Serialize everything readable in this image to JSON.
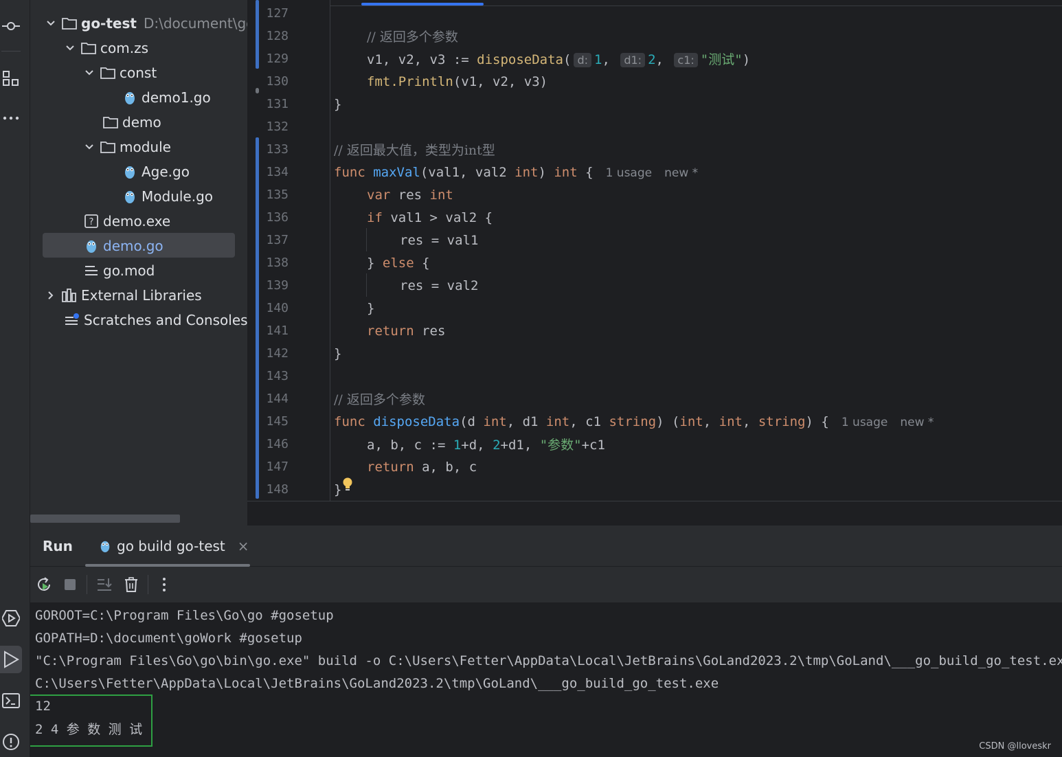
{
  "project": {
    "root_name": "go-test",
    "root_path": "D:\\document\\go\\",
    "items": [
      {
        "label": "com.zs",
        "type": "folder"
      },
      {
        "label": "const",
        "type": "folder"
      },
      {
        "label": "demo1.go",
        "type": "go-file"
      },
      {
        "label": "demo",
        "type": "folder"
      },
      {
        "label": "module",
        "type": "folder"
      },
      {
        "label": "Age.go",
        "type": "go-file"
      },
      {
        "label": "Module.go",
        "type": "go-file"
      },
      {
        "label": "demo.exe",
        "type": "unknown-file"
      },
      {
        "label": "demo.go",
        "type": "go-file",
        "selected": true
      },
      {
        "label": "go.mod",
        "type": "mod-file"
      },
      {
        "label": "External Libraries",
        "type": "library"
      },
      {
        "label": "Scratches and Consoles",
        "type": "scratches"
      }
    ]
  },
  "editor": {
    "line_numbers": [
      "127",
      "128",
      "129",
      "130",
      "131",
      "132",
      "133",
      "134",
      "135",
      "136",
      "137",
      "138",
      "139",
      "140",
      "141",
      "142",
      "143",
      "144",
      "145",
      "146",
      "147",
      "148"
    ],
    "inlay_hints": [
      "d:",
      "d1:",
      "c1:"
    ],
    "usage_hint": "1 usage",
    "new_hint": "new *",
    "code": {
      "l128_comment": "// 返回多个参数",
      "l129_lhs": "v1, v2, v3 := ",
      "l129_fn": "disposeData",
      "l129_a1": "1",
      "l129_a2": "2",
      "l129_a3": "\"测试\"",
      "l130_pkg": "fmt.",
      "l130_fn": "Println",
      "l130_args": "(v1, v2, v3)",
      "brace_close": "}",
      "l133_comment": "// 返回最大值，类型为int型",
      "kw_func": "func",
      "l134_fn": "maxVal",
      "l134_params": "(val1, val2 ",
      "type_int": "int",
      "type_string": "string",
      "l134_rest": ") ",
      "brace_open": " {",
      "kw_var": "var",
      "l135_name": " res ",
      "kw_if": "if",
      "l136_cond": " val1 > val2 {",
      "l137_stmt": "res = val1",
      "l138_close": "} ",
      "kw_else": "else",
      "l138_open": " {",
      "l139_stmt": "res = val2",
      "kw_return": "return",
      "l141_val": " res",
      "l144_comment": "// 返回多个参数",
      "l145_fn": "disposeData",
      "l145_p1": "(d ",
      "l145_p2": ", d1 ",
      "l145_p3": ", c1 ",
      "l145_p4": ") (",
      "comma": ", ",
      "l145_p5": ") {",
      "l146_a": "a, b, c := ",
      "l146_n1": "1",
      "l146_p": "+d, ",
      "l146_n2": "2",
      "l146_q": "+d1, ",
      "l146_s": "\"参数\"",
      "l146_r": "+c1",
      "l147_vals": " a, b, c"
    }
  },
  "run": {
    "title": "Run",
    "tab_label": "go build go-test",
    "close_glyph": "×",
    "console_lines": [
      "GOROOT=C:\\Program Files\\Go\\go #gosetup",
      "GOPATH=D:\\document\\goWork #gosetup",
      "\"C:\\Program Files\\Go\\go\\bin\\go.exe\" build -o C:\\Users\\Fetter\\AppData\\Local\\JetBrains\\GoLand2023.2\\tmp\\GoLand\\___go_build_go_test.exe",
      "C:\\Users\\Fetter\\AppData\\Local\\JetBrains\\GoLand2023.2\\tmp\\GoLand\\___go_build_go_test.exe",
      "12",
      "2 4 参 数 测 试"
    ]
  },
  "watermark": "CSDN @lloveskr",
  "colors": {
    "accent": "#3574f0",
    "output_highlight": "#2ea043",
    "keyword": "#cf8e6d",
    "function": "#56a8f5",
    "string": "#6aab73",
    "number": "#2aacb8"
  }
}
